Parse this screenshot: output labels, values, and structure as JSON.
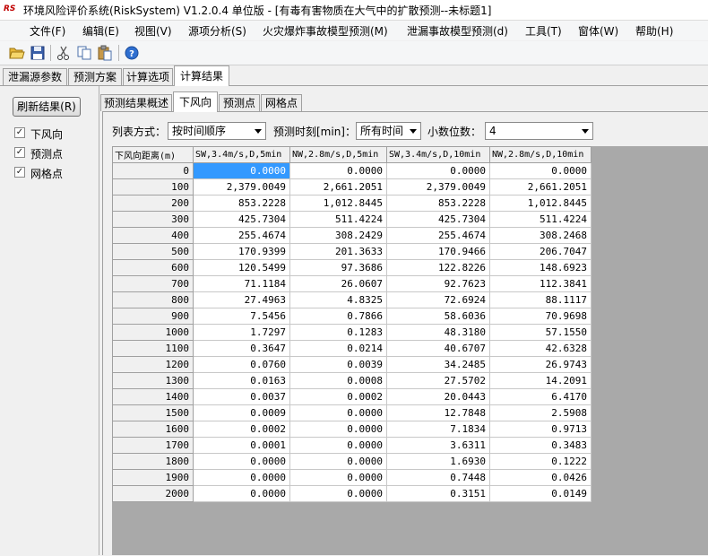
{
  "window": {
    "logo": "RS",
    "title": "环境风险评价系统(RiskSystem) V1.2.0.4 单位版 - [有毒有害物质在大气中的扩散预测--未标题1]"
  },
  "menu": [
    "文件(F)",
    "编辑(E)",
    "视图(V)",
    "源项分析(S)",
    "火灾爆炸事故模型预测(M)",
    "泄漏事故模型预测(d)",
    "工具(T)",
    "窗体(W)",
    "帮助(H)"
  ],
  "toolbar": {
    "icons": [
      "open-folder-icon",
      "save-icon",
      "cut-icon",
      "copy-icon",
      "paste-icon",
      "help-icon"
    ]
  },
  "top_tabs": [
    "泄漏源参数",
    "预测方案",
    "计算选项",
    "计算结果"
  ],
  "left": {
    "refresh_label": "刷新结果(R)",
    "checks": [
      {
        "label": "下风向",
        "checked": true
      },
      {
        "label": "预测点",
        "checked": true
      },
      {
        "label": "网格点",
        "checked": true
      }
    ]
  },
  "inner_tabs": [
    "预测结果概述",
    "下风向",
    "预测点",
    "网格点"
  ],
  "options": {
    "list_mode_label": "列表方式：",
    "list_mode_value": "按时间顺序",
    "time_label": "预测时刻[min]：",
    "time_value": "所有时间",
    "decimals_label": "小数位数：",
    "decimals_value": "4"
  },
  "grid": {
    "headers": [
      "下风向距离(m)",
      "SW,3.4m/s,D,5min",
      "NW,2.8m/s,D,5min",
      "SW,3.4m/s,D,10min",
      "NW,2.8m/s,D,10min"
    ],
    "rows": [
      [
        "0",
        "0.0000",
        "0.0000",
        "0.0000",
        "0.0000"
      ],
      [
        "100",
        "2,379.0049",
        "2,661.2051",
        "2,379.0049",
        "2,661.2051"
      ],
      [
        "200",
        "853.2228",
        "1,012.8445",
        "853.2228",
        "1,012.8445"
      ],
      [
        "300",
        "425.7304",
        "511.4224",
        "425.7304",
        "511.4224"
      ],
      [
        "400",
        "255.4674",
        "308.2429",
        "255.4674",
        "308.2468"
      ],
      [
        "500",
        "170.9399",
        "201.3633",
        "170.9466",
        "206.7047"
      ],
      [
        "600",
        "120.5499",
        "97.3686",
        "122.8226",
        "148.6923"
      ],
      [
        "700",
        "71.1184",
        "26.0607",
        "92.7623",
        "112.3841"
      ],
      [
        "800",
        "27.4963",
        "4.8325",
        "72.6924",
        "88.1117"
      ],
      [
        "900",
        "7.5456",
        "0.7866",
        "58.6036",
        "70.9698"
      ],
      [
        "1000",
        "1.7297",
        "0.1283",
        "48.3180",
        "57.1550"
      ],
      [
        "1100",
        "0.3647",
        "0.0214",
        "40.6707",
        "42.6328"
      ],
      [
        "1200",
        "0.0760",
        "0.0039",
        "34.2485",
        "26.9743"
      ],
      [
        "1300",
        "0.0163",
        "0.0008",
        "27.5702",
        "14.2091"
      ],
      [
        "1400",
        "0.0037",
        "0.0002",
        "20.0443",
        "6.4170"
      ],
      [
        "1500",
        "0.0009",
        "0.0000",
        "12.7848",
        "2.5908"
      ],
      [
        "1600",
        "0.0002",
        "0.0000",
        "7.1834",
        "0.9713"
      ],
      [
        "1700",
        "0.0001",
        "0.0000",
        "3.6311",
        "0.3483"
      ],
      [
        "1800",
        "0.0000",
        "0.0000",
        "1.6930",
        "0.1222"
      ],
      [
        "1900",
        "0.0000",
        "0.0000",
        "0.7448",
        "0.0426"
      ],
      [
        "2000",
        "0.0000",
        "0.0000",
        "0.3151",
        "0.0149"
      ]
    ]
  }
}
